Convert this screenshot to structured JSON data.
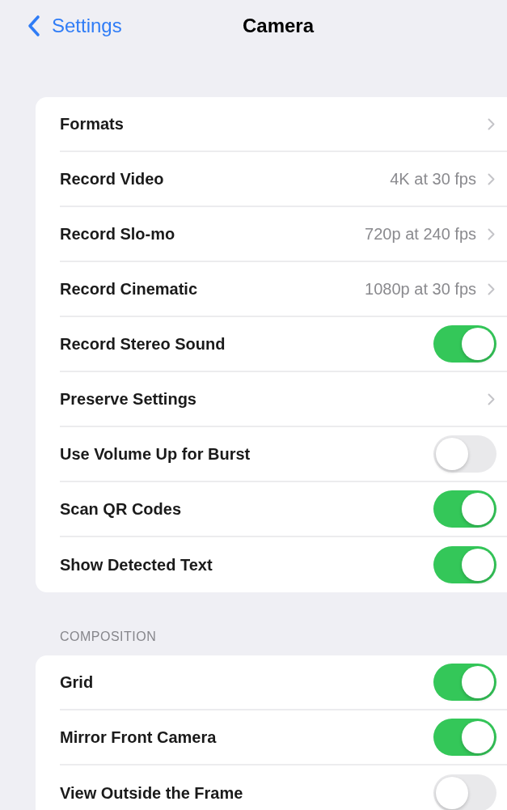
{
  "nav": {
    "back": "Settings",
    "title": "Camera"
  },
  "sections": [
    {
      "items": [
        {
          "kind": "link",
          "label": "Formats"
        },
        {
          "kind": "link",
          "label": "Record Video",
          "value": "4K at 30 fps"
        },
        {
          "kind": "link",
          "label": "Record Slo-mo",
          "value": "720p at 240 fps"
        },
        {
          "kind": "link",
          "label": "Record Cinematic",
          "value": "1080p at 30 fps"
        },
        {
          "kind": "toggle",
          "label": "Record Stereo Sound",
          "on": true
        },
        {
          "kind": "link",
          "label": "Preserve Settings"
        },
        {
          "kind": "toggle",
          "label": "Use Volume Up for Burst",
          "on": false
        },
        {
          "kind": "toggle",
          "label": "Scan QR Codes",
          "on": true
        },
        {
          "kind": "toggle",
          "label": "Show Detected Text",
          "on": true
        }
      ]
    },
    {
      "header": "COMPOSITION",
      "items": [
        {
          "kind": "toggle",
          "label": "Grid",
          "on": true
        },
        {
          "kind": "toggle",
          "label": "Mirror Front Camera",
          "on": true
        },
        {
          "kind": "toggle",
          "label": "View Outside the Frame",
          "on": false
        }
      ]
    }
  ]
}
